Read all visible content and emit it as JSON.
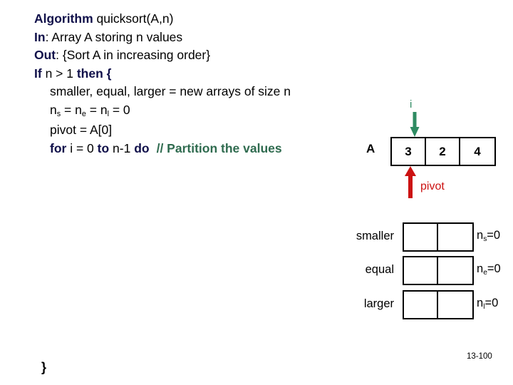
{
  "slide": {
    "page_number": "13-100",
    "closing_brace": "}"
  },
  "pseudocode": {
    "lines": [
      {
        "kw1": "Algorithm",
        "rest": " quicksort(A,n)"
      },
      {
        "kw1": "In",
        "rest": ": Array A storing n values"
      },
      {
        "kw1": "Out",
        "rest": ": {Sort A in increasing order}"
      },
      {
        "kw1": "If",
        "mid": " n > 1 ",
        "kw2": "then",
        "tail": " {"
      }
    ],
    "line_smaller": "smaller, equal, larger = new arrays of size n",
    "line_counters_prefix": "n",
    "line_counters": {
      "n1": "n",
      "s1": "s",
      "eq1": " = ",
      "n2": "n",
      "s2": "e",
      "eq2": " = ",
      "n3": "n",
      "s3": "l",
      "eq3": " = 0"
    },
    "line_pivot": "pivot = A[0]",
    "line_for": {
      "kw_for": "for",
      "mid1": " i = 0 ",
      "kw_to": "to",
      "mid2": " n-1 ",
      "kw_do": "do",
      "comment": "// Partition the values"
    }
  },
  "array_diagram": {
    "name_label": "A",
    "index_pointer_label": "i",
    "pivot_pointer_label": "pivot",
    "cells": [
      "3",
      "2",
      "4"
    ],
    "index_arrow_color": "#2e8b62",
    "pivot_arrow_color": "#cc1212"
  },
  "partitions": {
    "rows": [
      {
        "label": "smaller",
        "cells": [
          "",
          ""
        ],
        "counter_var": "n",
        "counter_sub": "s",
        "counter_value": "=0"
      },
      {
        "label": "equal",
        "cells": [
          "",
          ""
        ],
        "counter_var": "n",
        "counter_sub": "e",
        "counter_value": "=0"
      },
      {
        "label": "larger",
        "cells": [
          "",
          ""
        ],
        "counter_var": "n",
        "counter_sub": "l",
        "counter_value": "=0"
      }
    ]
  }
}
